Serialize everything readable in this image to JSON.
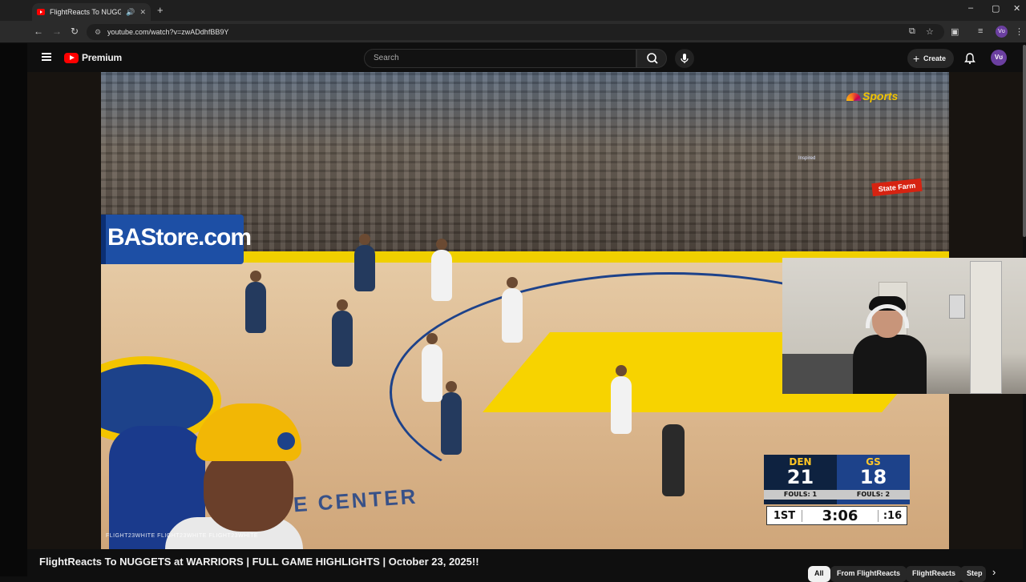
{
  "browser": {
    "tab_title": "FlightReacts To NUGGETS a",
    "new_tab_symbol": "+",
    "address": "youtube.com/watch?v=zwADdhfBB9Y",
    "window_controls": {
      "minimize": "–",
      "maximize": "▢",
      "close": "✕"
    }
  },
  "header": {
    "brand": "Premium",
    "search_placeholder": "Search",
    "create_label": "Create",
    "avatar_initials": "Vʊ"
  },
  "video": {
    "court_ad": "BAStore.com",
    "court_text": "E CENTER",
    "network_logo": "Sports",
    "sponsor": "State Farm",
    "chat_line": "Inspired",
    "socials": "FLIGHT23WHITE  FLIGHT23WHITE  FLIGHT23WHITE"
  },
  "scoreboard": {
    "home_abbr": "DEN",
    "home_score": "21",
    "home_fouls": "FOULS: 1",
    "away_abbr": "GS",
    "away_score": "18",
    "away_fouls": "FOULS: 2",
    "period": "1ST",
    "clock": "3:06",
    "shot_clock": ":16"
  },
  "title": "FlightReacts To NUGGETS at WARRIORS | FULL GAME HIGHLIGHTS | October 23, 2025!!",
  "chips": [
    "All",
    "From FlightReacts",
    "FlightReacts",
    "Step"
  ],
  "colors": {
    "accent": "#ff0000",
    "den_navy": "#0e2240",
    "gs_blue": "#1d428a",
    "gold": "#fec524"
  }
}
